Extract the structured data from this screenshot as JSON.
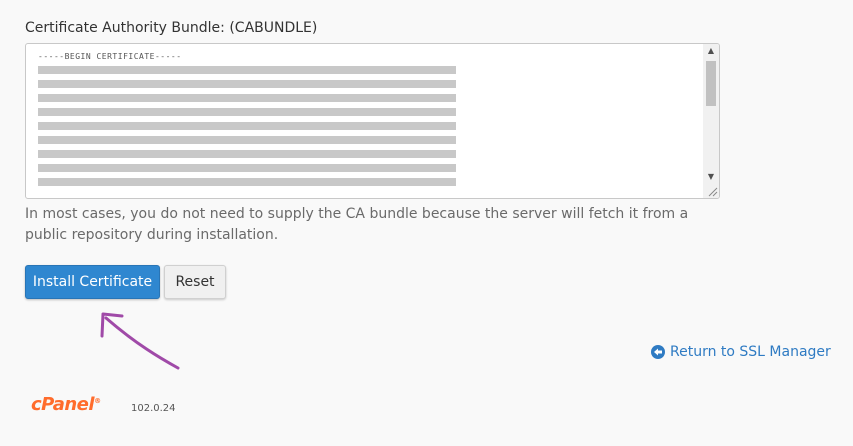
{
  "form": {
    "label": "Certificate Authority Bundle: (CABUNDLE)",
    "textarea_first_line": "-----BEGIN CERTIFICATE-----",
    "help_text": "In most cases, you do not need to supply the CA bundle because the server will fetch it from a public repository during installation."
  },
  "buttons": {
    "install_label": "Install Certificate",
    "reset_label": "Reset"
  },
  "links": {
    "return_label": "Return to SSL Manager"
  },
  "footer": {
    "logo_text": "cPanel",
    "logo_mark": "®",
    "version": "102.0.24"
  },
  "icons": {
    "return_link_icon": "circle-arrow-left-icon",
    "scroll_up": "triangle-up-icon",
    "scroll_down": "triangle-down-icon"
  },
  "colors": {
    "primary_button": "#2f87d0",
    "link": "#2f7bc3",
    "brand": "#ff6c2c",
    "annotation": "#a04aa8"
  }
}
